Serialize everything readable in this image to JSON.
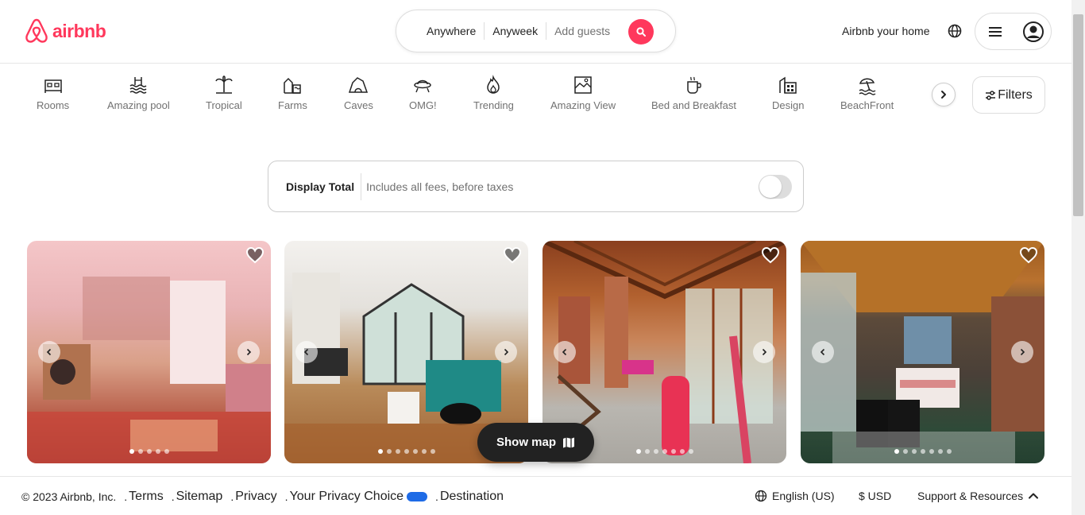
{
  "header": {
    "logo_text": "airbnb",
    "search": {
      "where": "Anywhere",
      "when": "Anyweek",
      "guests_placeholder": "Add guests"
    },
    "host_link": "Airbnb your home"
  },
  "categories": {
    "items": [
      {
        "label": "Rooms",
        "icon": "bed-icon"
      },
      {
        "label": "Amazing pool",
        "icon": "pool-icon"
      },
      {
        "label": "Tropical",
        "icon": "palm-tree-icon"
      },
      {
        "label": "Farms",
        "icon": "farm-icon"
      },
      {
        "label": "Caves",
        "icon": "cave-icon"
      },
      {
        "label": "OMG!",
        "icon": "ufo-icon"
      },
      {
        "label": "Trending",
        "icon": "flame-icon"
      },
      {
        "label": "Amazing View",
        "icon": "view-icon"
      },
      {
        "label": "Bed and Breakfast",
        "icon": "coffee-icon"
      },
      {
        "label": "Design",
        "icon": "building-icon"
      },
      {
        "label": "BeachFront",
        "icon": "beach-icon"
      }
    ],
    "filters_label": "Filters"
  },
  "display_total": {
    "label": "Display Total",
    "subtext": "Includes all fees, before taxes",
    "toggle_on": false
  },
  "listings": [
    {
      "name": "listing-1",
      "heart_filled": true,
      "active_dot": 0
    },
    {
      "name": "listing-2",
      "heart_filled": true,
      "active_dot": 0
    },
    {
      "name": "listing-3",
      "heart_filled": true,
      "active_dot": 0
    },
    {
      "name": "listing-4",
      "heart_filled": false,
      "active_dot": 0
    }
  ],
  "show_map_label": "Show map",
  "footer": {
    "copyright": "© 2023 Airbnb, Inc.",
    "links": [
      "Terms",
      "Sitemap",
      "Privacy",
      "Your Privacy Choice",
      "Destination"
    ],
    "language": "English (US)",
    "currency": "$ USD",
    "support": "Support & Resources"
  },
  "colors": {
    "brand": "#ff385c",
    "text": "#222222",
    "muted": "#717171",
    "privacy_badge": "#1e6be6"
  }
}
